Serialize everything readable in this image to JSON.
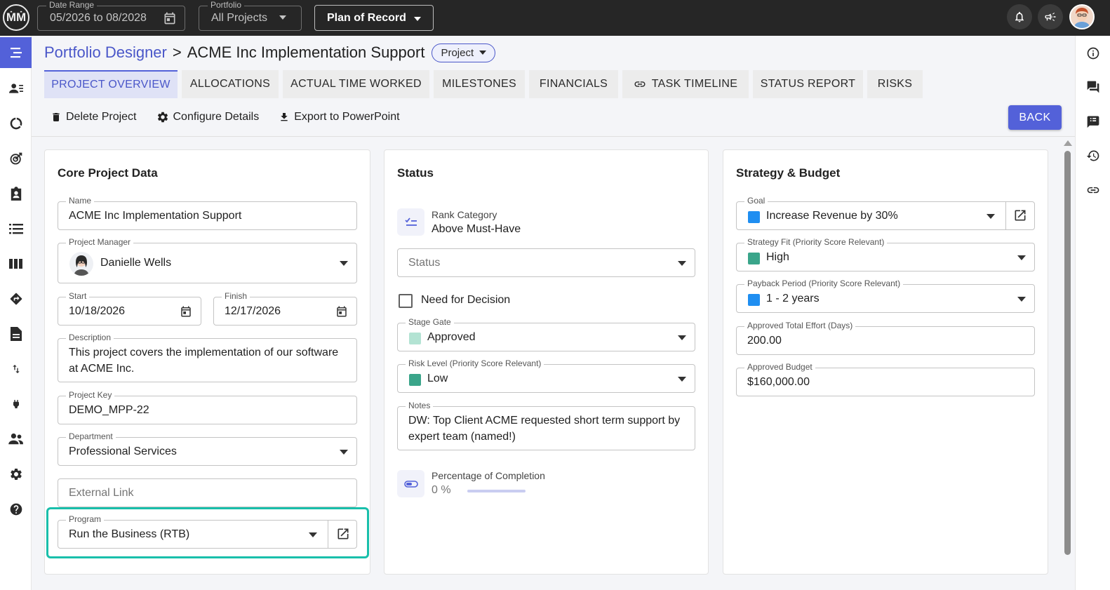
{
  "topbar": {
    "logo_text": "ṀṀ",
    "date_range_label": "Date Range",
    "date_range_value": "05/2026 to 08/2028",
    "portfolio_label": "Portfolio",
    "portfolio_value": "All Projects",
    "plan_value": "Plan of Record"
  },
  "breadcrumb": {
    "root": "Portfolio Designer",
    "separator": ">",
    "current": "ACME Inc Implementation Support",
    "chip": "Project"
  },
  "tabs": [
    {
      "label": "PROJECT OVERVIEW",
      "active": true
    },
    {
      "label": "ALLOCATIONS"
    },
    {
      "label": "ACTUAL TIME WORKED"
    },
    {
      "label": "MILESTONES"
    },
    {
      "label": "FINANCIALS"
    },
    {
      "label": "TASK TIMELINE"
    },
    {
      "label": "STATUS REPORT"
    },
    {
      "label": "RISKS"
    }
  ],
  "actions": {
    "delete": "Delete Project",
    "configure": "Configure Details",
    "export": "Export to PowerPoint",
    "back": "BACK"
  },
  "core": {
    "title": "Core Project Data",
    "name_label": "Name",
    "name_value": "ACME Inc Implementation Support",
    "pm_label": "Project Manager",
    "pm_value": "Danielle Wells",
    "start_label": "Start",
    "start_value": "10/18/2026",
    "finish_label": "Finish",
    "finish_value": "12/17/2026",
    "desc_label": "Description",
    "desc_value": "This project covers the implementation of our software at ACME Inc.",
    "key_label": "Project Key",
    "key_value": "DEMO_MPP-22",
    "dept_label": "Department",
    "dept_value": "Professional Services",
    "link_placeholder": "External Link",
    "program_label": "Program",
    "program_value": "Run the Business (RTB)"
  },
  "status": {
    "title": "Status",
    "rank_label": "Rank Category",
    "rank_value": "Above Must-Have",
    "status_placeholder": "Status",
    "need_decision": "Need for Decision",
    "stage_label": "Stage Gate",
    "stage_value": "Approved",
    "stage_color": "#b3e3d3",
    "risk_label": "Risk Level (Priority Score Relevant)",
    "risk_value": "Low",
    "risk_color": "#3aa58a",
    "notes_label": "Notes",
    "notes_value": "DW: Top Client ACME requested short term support by expert team (named!)",
    "pct_label": "Percentage of Completion",
    "pct_value": "0 %",
    "pct_fraction": 0
  },
  "strategy": {
    "title": "Strategy & Budget",
    "goal_label": "Goal",
    "goal_value": "Increase Revenue by 30%",
    "goal_color": "#1f8ef1",
    "fit_label": "Strategy Fit (Priority Score Relevant)",
    "fit_value": "High",
    "fit_color": "#3aa58a",
    "payback_label": "Payback Period (Priority Score Relevant)",
    "payback_value": "1 - 2 years",
    "payback_color": "#1f8ef1",
    "effort_label": "Approved Total Effort (Days)",
    "effort_value": "200.00",
    "budget_label": "Approved Budget",
    "budget_value": "$160,000.00"
  },
  "icons": {
    "left_nav": [
      "menu-icon",
      "person-list-icon",
      "donut-chart-icon",
      "target-icon",
      "clipboard-user-icon",
      "list-icon",
      "columns-icon",
      "direction-sign-icon",
      "document-icon",
      "swap-vertical-icon",
      "plug-icon",
      "group-icon",
      "gear-icon",
      "help-icon"
    ],
    "right_nav": [
      "info-icon",
      "forum-icon",
      "feedback-icon",
      "history-icon",
      "link-icon"
    ]
  },
  "colors": {
    "accent": "#5361d9",
    "highlight": "#19bfab"
  }
}
